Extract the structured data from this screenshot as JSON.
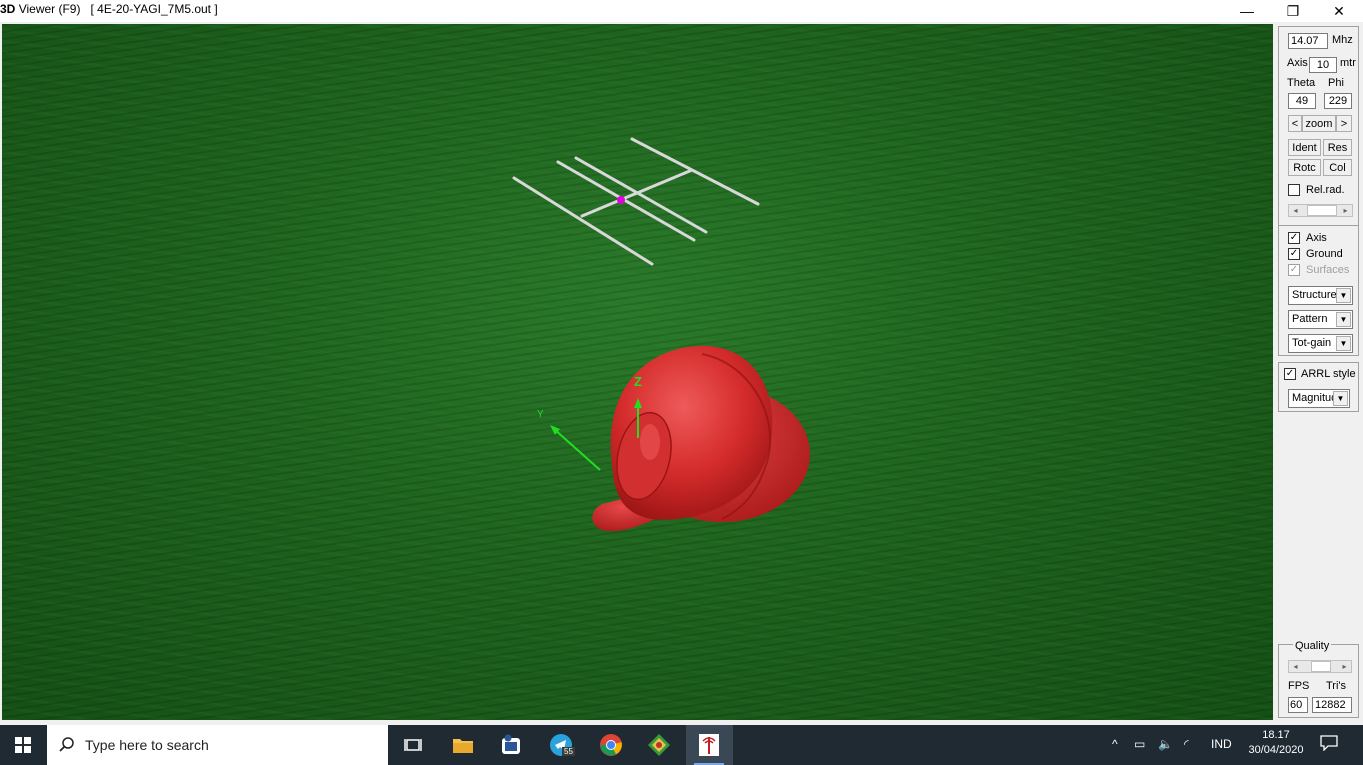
{
  "window": {
    "app": "3D",
    "title": "Viewer (F9)",
    "file": "[ 4E-20-YAGI_7M5.out ]",
    "minimize": "—",
    "maximize": "❐",
    "close": "✕"
  },
  "controls": {
    "freq_value": "14.07",
    "freq_unit": "Mhz",
    "axis_label": "Axis",
    "axis_value": "10",
    "axis_unit": "mtr",
    "theta_label": "Theta",
    "phi_label": "Phi",
    "theta_value": "49",
    "phi_value": "229",
    "zoom_prev": "<",
    "zoom_label": "zoom",
    "zoom_next": ">",
    "ident": "Ident",
    "res": "Res",
    "rotc": "Rotc",
    "col": "Col",
    "relrad_label": "Rel.rad.",
    "relrad_checked": false,
    "relrad_level": 0.45,
    "axis_check_label": "Axis",
    "axis_checked": true,
    "ground_label": "Ground",
    "ground_checked": true,
    "surfaces_label": "Surfaces",
    "surfaces_checked": true,
    "structure_select": "Structure",
    "pattern_select": "Pattern",
    "totgain_select": "Tot-gain",
    "arrl_label": "ARRL style",
    "arrl_checked": true,
    "magnitude_select": "Magnitud"
  },
  "quality": {
    "title": "Quality",
    "level": 0.45,
    "fps_label": "FPS",
    "tris_label": "Tri's",
    "fps_value": "60",
    "tris_value": "12882"
  },
  "scene": {
    "ground_color": "#1e631e",
    "pattern_color": "#d42b2b",
    "element_color": "#d8d8d8",
    "feed_color": "#e000e0",
    "axis_color": "#22dd22",
    "axis_z_label": "Z",
    "axis_y_label": "Y"
  },
  "taskbar": {
    "search_placeholder": "Type here to search",
    "telegram_badge": "55",
    "language": "IND",
    "time": "18.17",
    "date": "30/04/2020"
  }
}
